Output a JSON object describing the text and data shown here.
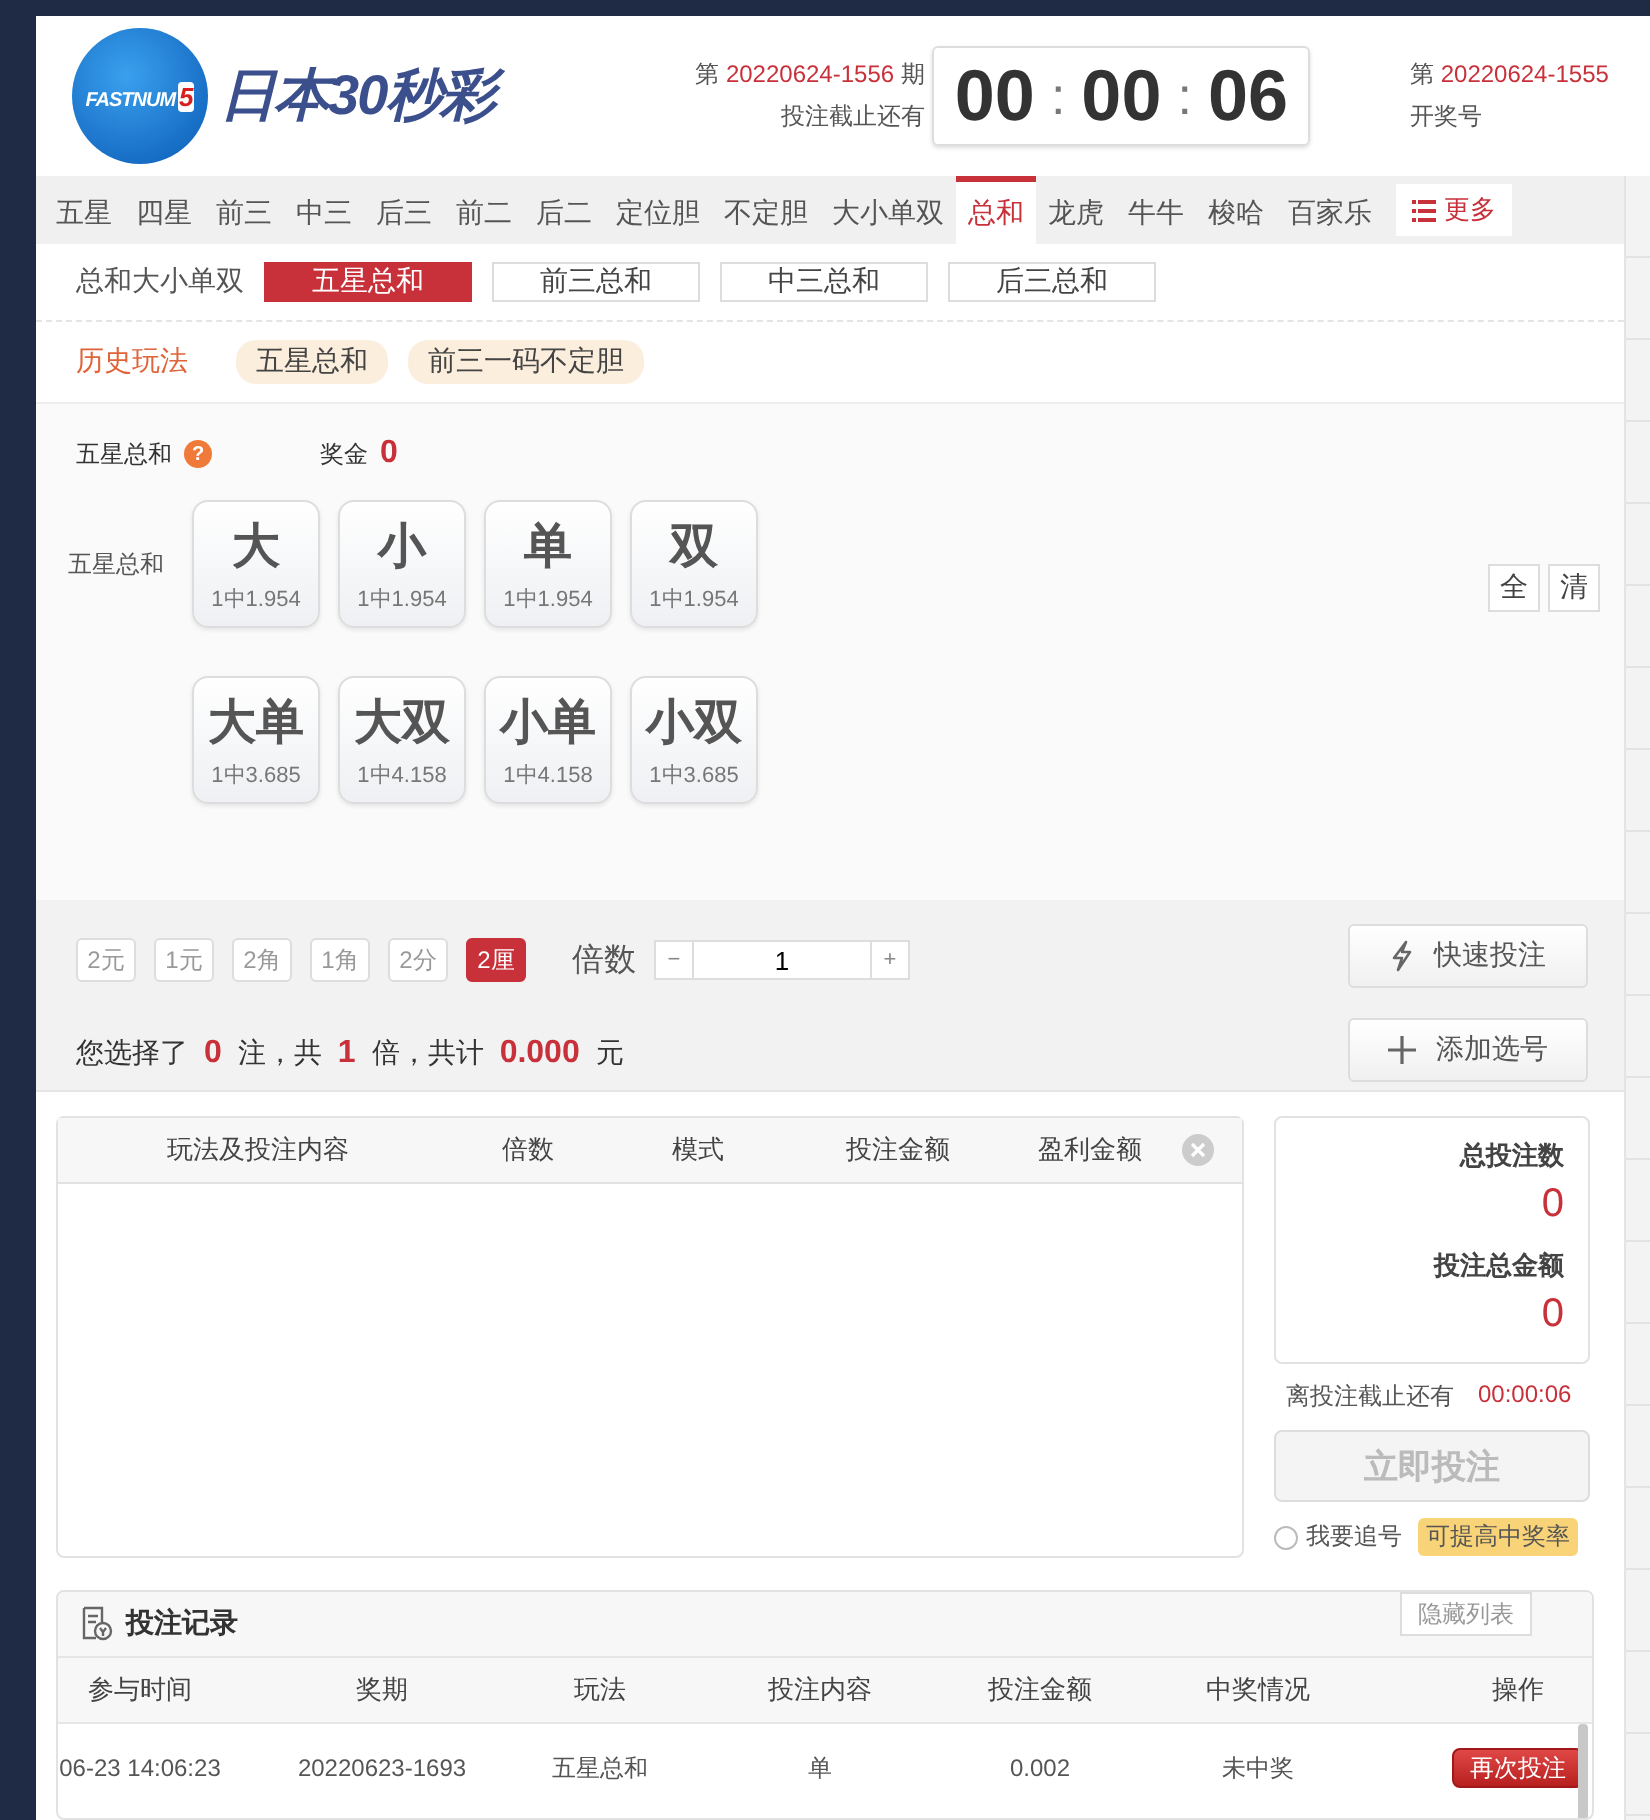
{
  "logo": {
    "badge_text": "FASTNUM",
    "badge_number": "5",
    "title": "日本30秒彩"
  },
  "current_draw": {
    "prefix": "第",
    "issue": "20220624-1556",
    "suffix": "期",
    "caption": "投注截止还有"
  },
  "countdown": {
    "hours": "00",
    "minutes": "00",
    "seconds": "06",
    "separators": [
      ":",
      ":"
    ]
  },
  "previous_draw": {
    "prefix": "第",
    "issue": "20220624-1555",
    "caption": "开奖号"
  },
  "tabs": [
    {
      "label": "五星",
      "selected": false
    },
    {
      "label": "四星",
      "selected": false
    },
    {
      "label": "前三",
      "selected": false
    },
    {
      "label": "中三",
      "selected": false
    },
    {
      "label": "后三",
      "selected": false
    },
    {
      "label": "前二",
      "selected": false
    },
    {
      "label": "后二",
      "selected": false
    },
    {
      "label": "定位胆",
      "selected": false
    },
    {
      "label": "不定胆",
      "selected": false
    },
    {
      "label": "大小单双",
      "selected": false
    },
    {
      "label": "总和",
      "selected": true
    },
    {
      "label": "龙虎",
      "selected": false
    },
    {
      "label": "牛牛",
      "selected": false
    },
    {
      "label": "梭哈",
      "selected": false
    },
    {
      "label": "百家乐",
      "selected": false
    }
  ],
  "more_button": "更多",
  "subtabs": {
    "label": "总和大小单双",
    "items": [
      {
        "label": "五星总和",
        "selected": true
      },
      {
        "label": "前三总和",
        "selected": false
      },
      {
        "label": "中三总和",
        "selected": false
      },
      {
        "label": "后三总和",
        "selected": false
      }
    ]
  },
  "history": {
    "label": "历史玩法",
    "items": [
      "五星总和",
      "前三一码不定胆"
    ]
  },
  "play": {
    "name": "五星总和",
    "help": "?",
    "prize_label": "奖金",
    "prize": "0",
    "row_label": "五星总和",
    "balls": [
      [
        {
          "label": "大",
          "odds": "1中1.954"
        },
        {
          "label": "小",
          "odds": "1中1.954"
        },
        {
          "label": "单",
          "odds": "1中1.954"
        },
        {
          "label": "双",
          "odds": "1中1.954"
        }
      ],
      [
        {
          "label": "大单",
          "odds": "1中3.685"
        },
        {
          "label": "大双",
          "odds": "1中4.158"
        },
        {
          "label": "小单",
          "odds": "1中4.158"
        },
        {
          "label": "小双",
          "odds": "1中3.685"
        }
      ]
    ],
    "quick_buttons": [
      "全",
      "清"
    ]
  },
  "units": [
    {
      "label": "2元",
      "selected": false
    },
    {
      "label": "1元",
      "selected": false
    },
    {
      "label": "2角",
      "selected": false
    },
    {
      "label": "1角",
      "selected": false
    },
    {
      "label": "2分",
      "selected": false
    },
    {
      "label": "2厘",
      "selected": true
    }
  ],
  "multiplier": {
    "label": "倍数",
    "minus": "−",
    "value": "1",
    "plus": "+"
  },
  "summary": {
    "parts": [
      "您选择了",
      "0",
      "注，共",
      "1",
      "倍，共计",
      "0.000",
      "元"
    ]
  },
  "quick_bet_button": "快速投注",
  "add_button": "添加选号",
  "cart": {
    "columns": [
      "玩法及投注内容",
      "倍数",
      "模式",
      "投注金额",
      "盈利金额"
    ]
  },
  "totals": {
    "count_label": "总投注数",
    "count": "0",
    "amount_label": "投注总金额",
    "amount": "0",
    "deadline_label": "离投注截止还有",
    "deadline": "00:00:06",
    "submit": "立即投注",
    "chase": {
      "label": "我要追号",
      "checked": false
    },
    "chase_tip": "可提高中奖率"
  },
  "records": {
    "title": "投注记录",
    "hide_button": "隐藏列表",
    "columns": [
      "参与时间",
      "奖期",
      "玩法",
      "投注内容",
      "投注金额",
      "中奖情况",
      "操作"
    ],
    "rows": [
      {
        "time": "06-23 14:06:23",
        "issue": "20220623-1693",
        "play": "五星总和",
        "content": "单",
        "amount": "0.002",
        "result": "未中奖",
        "action": "再次投注"
      }
    ]
  }
}
